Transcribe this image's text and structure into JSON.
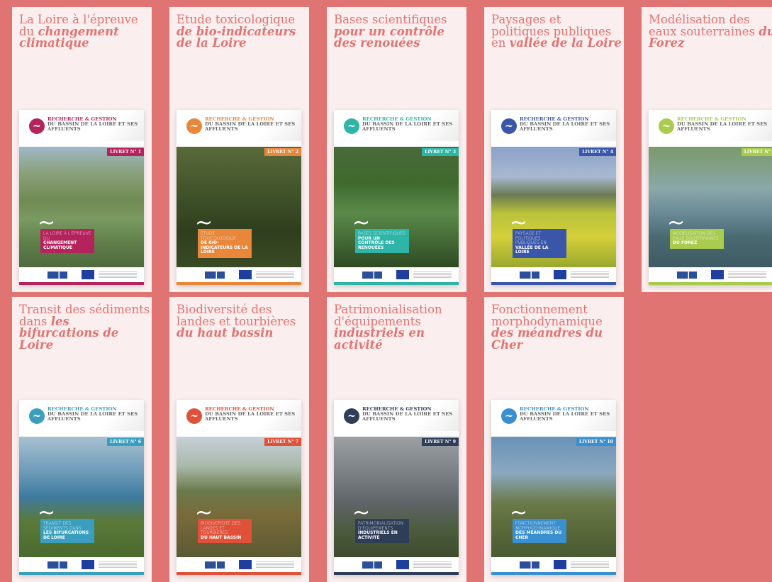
{
  "cover_brand": {
    "line1": "RECHERCHE & GESTION",
    "line2": "DU BASSIN DE LA LOIRE ET SES AFFLUENTS"
  },
  "cards": [
    {
      "title_plain": "La Loire à l'épreuve du ",
      "title_em": "changement climatique",
      "livret": "LIVRET N° 1",
      "cover_light": "LA LOIRE À L'ÉPREUVE DU",
      "cover_bold": "CHANGEMENT CLIMATIQUE",
      "accent": "#b5235c"
    },
    {
      "title_plain": "Etude toxicologique ",
      "title_em": "de bio-indicateurs de la Loire",
      "livret": "LIVRET N° 2",
      "cover_light": "ÉTUDE TOXICOLOGIQUE",
      "cover_bold": "DE BIO-INDICATEURS DE LA LOIRE",
      "accent": "#e8873a"
    },
    {
      "title_plain": "Bases scientifiques ",
      "title_em": "pour un contrôle des renouées",
      "livret": "LIVRET N° 3",
      "cover_light": "BASES SCIENTIFIQUES",
      "cover_bold": "POUR UN CONTRÔLE DES RENOUÉES",
      "accent": "#2fb5a8"
    },
    {
      "title_plain": "Paysages et politiques publiques en ",
      "title_em": "vallée de la Loire",
      "livret": "LIVRET N° 4",
      "cover_light": "PAYSAGE ET POLITIQUES PUBLIQUES EN",
      "cover_bold": "VALLÉE DE LA LOIRE",
      "accent": "#3a56a8"
    },
    {
      "title_plain": "Modélisation des eaux souterraines ",
      "title_em": "du Forez",
      "livret": "LIVRET N°",
      "cover_light": "MODÉLISATION DES EAUX SOUTERRAINES",
      "cover_bold": "DU FOREZ",
      "accent": "#a9cb4f"
    },
    {
      "title_plain": "Transit des sédiments dans ",
      "title_em": "les bifurcations de Loire",
      "livret": "LIVRET N° 6",
      "cover_light": "TRANSIT DES SÉDIMENTS DANS",
      "cover_bold": "LES BIFURCATIONS DE LOIRE",
      "accent": "#3a9fbf"
    },
    {
      "title_plain": "Biodiversité des landes et tourbières ",
      "title_em": "du haut bassin",
      "livret": "LIVRET N° 7",
      "cover_light": "BIODIVERSITÉ DES LANDES ET TOURBIÈRES",
      "cover_bold": "DU HAUT BASSIN",
      "accent": "#e0513a"
    },
    {
      "title_plain": "Patrimonialisation d'équipements ",
      "title_em": "industriels en activité",
      "livret": "LIVRET N° 9",
      "cover_light": "PATRIMONIALISATION D'ÉQUIPEMENTS",
      "cover_bold": "INDUSTRIELS EN ACTIVITÉ",
      "accent": "#2e3e58"
    },
    {
      "title_plain": "Fonctionnement morphodynamique ",
      "title_em": "des méandres du Cher",
      "livret": "LIVRET N° 10",
      "cover_light": "FONCTIONNEMENT MORPHODYNAMIQUE",
      "cover_bold": "DES MÉANDRES DU CHER",
      "accent": "#3a8fd0"
    }
  ]
}
